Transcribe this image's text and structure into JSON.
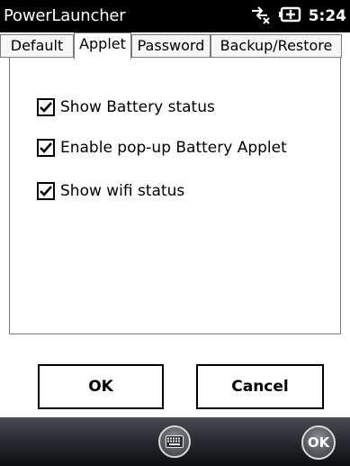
{
  "titlebar": {
    "title": "PowerLauncher",
    "time": "5:24",
    "icons": [
      "connectivity-icon",
      "battery-icon"
    ]
  },
  "tabs": [
    {
      "label": "Default",
      "active": false
    },
    {
      "label": "Applet",
      "active": true
    },
    {
      "label": "Password",
      "active": false
    },
    {
      "label": "Backup/Restore",
      "active": false
    }
  ],
  "options": [
    {
      "label": "Show Battery status",
      "checked": true
    },
    {
      "label": "Enable pop-up Battery Applet",
      "checked": true
    },
    {
      "label": "Show wifi status",
      "checked": true
    }
  ],
  "buttons": {
    "ok": "OK",
    "cancel": "Cancel"
  },
  "bottombar": {
    "keyboard_icon": "keyboard-icon",
    "ok_label": "OK"
  }
}
